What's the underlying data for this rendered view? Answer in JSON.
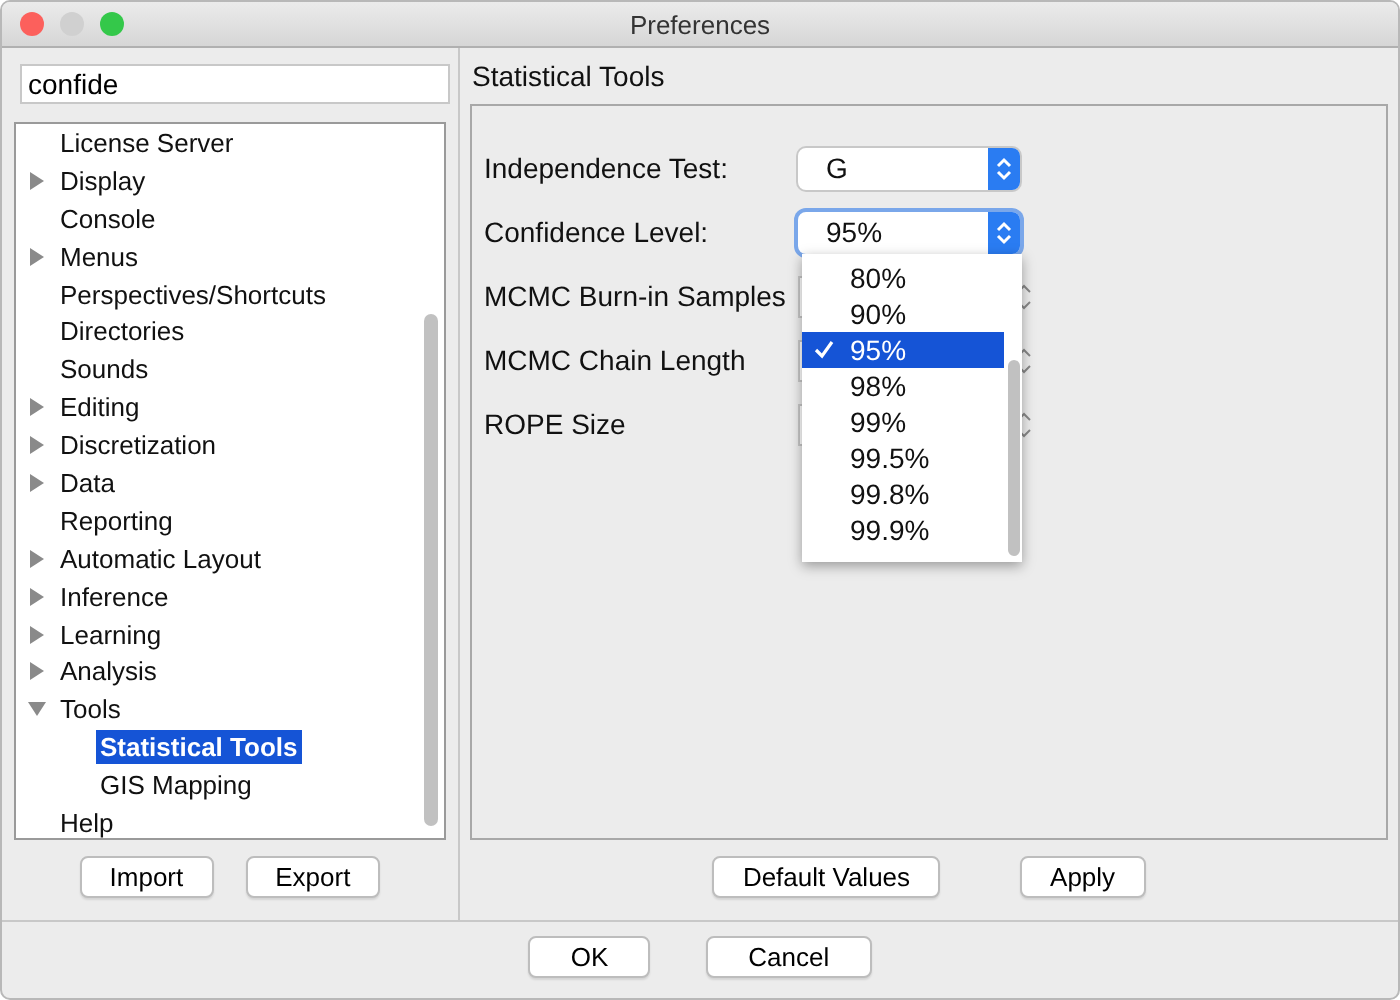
{
  "window": {
    "title": "Preferences"
  },
  "search": {
    "value": "confide"
  },
  "tree": [
    {
      "label": "License Server",
      "kind": "leaf",
      "selected": false
    },
    {
      "label": "Display",
      "kind": "group",
      "expanded": false,
      "selected": false
    },
    {
      "label": "Console",
      "kind": "leaf",
      "selected": false
    },
    {
      "label": "Menus",
      "kind": "group",
      "expanded": false,
      "selected": false
    },
    {
      "label": "Perspectives/Shortcuts",
      "kind": "leaf",
      "selected": false
    },
    {
      "label": "Directories",
      "kind": "leaf",
      "selected": false
    },
    {
      "label": "Sounds",
      "kind": "leaf",
      "selected": false
    },
    {
      "label": "Editing",
      "kind": "group",
      "expanded": false,
      "selected": false
    },
    {
      "label": "Discretization",
      "kind": "group",
      "expanded": false,
      "selected": false
    },
    {
      "label": "Data",
      "kind": "group",
      "expanded": false,
      "selected": false
    },
    {
      "label": "Reporting",
      "kind": "leaf",
      "selected": false
    },
    {
      "label": "Automatic Layout",
      "kind": "group",
      "expanded": false,
      "selected": false
    },
    {
      "label": "Inference",
      "kind": "group",
      "expanded": false,
      "selected": false
    },
    {
      "label": "Learning",
      "kind": "group",
      "expanded": false,
      "selected": false
    },
    {
      "label": "Analysis",
      "kind": "group",
      "expanded": false,
      "selected": false
    },
    {
      "label": "Tools",
      "kind": "group",
      "expanded": true,
      "selected": false,
      "children": [
        {
          "label": "Statistical Tools",
          "kind": "leaf",
          "selected": true
        },
        {
          "label": "GIS Mapping",
          "kind": "leaf",
          "selected": false
        }
      ]
    },
    {
      "label": "Help",
      "kind": "leaf",
      "selected": false
    }
  ],
  "left_buttons": [
    "Import",
    "Export"
  ],
  "panel": {
    "title": "Statistical Tools",
    "fields": [
      {
        "label": "Independence Test:",
        "kind": "combo",
        "value": "G",
        "open": false
      },
      {
        "label": "Confidence Level:",
        "kind": "combo",
        "value": "95%",
        "open": true,
        "options": [
          {
            "label": "80%",
            "selected": false
          },
          {
            "label": "90%",
            "selected": false
          },
          {
            "label": "95%",
            "selected": true
          },
          {
            "label": "98%",
            "selected": false
          },
          {
            "label": "99%",
            "selected": false
          },
          {
            "label": "99.5%",
            "selected": false
          },
          {
            "label": "99.8%",
            "selected": false
          },
          {
            "label": "99.9%",
            "selected": false
          }
        ]
      },
      {
        "label": "MCMC Burn-in Samples",
        "kind": "spinner"
      },
      {
        "label": "MCMC Chain Length",
        "kind": "spinner"
      },
      {
        "label": "ROPE Size",
        "kind": "spinner"
      }
    ]
  },
  "panel_buttons": [
    "Default Values",
    "Apply"
  ],
  "dialog_buttons": [
    "OK",
    "Cancel"
  ]
}
